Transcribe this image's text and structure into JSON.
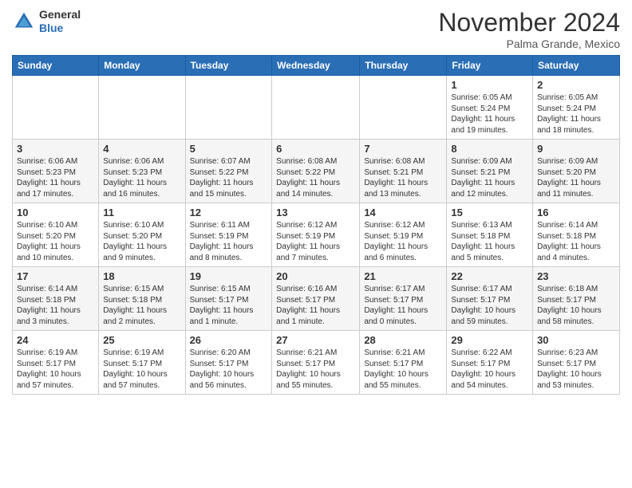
{
  "header": {
    "logo_line1": "General",
    "logo_line2": "Blue",
    "month": "November 2024",
    "location": "Palma Grande, Mexico"
  },
  "weekdays": [
    "Sunday",
    "Monday",
    "Tuesday",
    "Wednesday",
    "Thursday",
    "Friday",
    "Saturday"
  ],
  "weeks": [
    [
      {
        "day": "",
        "info": ""
      },
      {
        "day": "",
        "info": ""
      },
      {
        "day": "",
        "info": ""
      },
      {
        "day": "",
        "info": ""
      },
      {
        "day": "",
        "info": ""
      },
      {
        "day": "1",
        "info": "Sunrise: 6:05 AM\nSunset: 5:24 PM\nDaylight: 11 hours and 19 minutes."
      },
      {
        "day": "2",
        "info": "Sunrise: 6:05 AM\nSunset: 5:24 PM\nDaylight: 11 hours and 18 minutes."
      }
    ],
    [
      {
        "day": "3",
        "info": "Sunrise: 6:06 AM\nSunset: 5:23 PM\nDaylight: 11 hours and 17 minutes."
      },
      {
        "day": "4",
        "info": "Sunrise: 6:06 AM\nSunset: 5:23 PM\nDaylight: 11 hours and 16 minutes."
      },
      {
        "day": "5",
        "info": "Sunrise: 6:07 AM\nSunset: 5:22 PM\nDaylight: 11 hours and 15 minutes."
      },
      {
        "day": "6",
        "info": "Sunrise: 6:08 AM\nSunset: 5:22 PM\nDaylight: 11 hours and 14 minutes."
      },
      {
        "day": "7",
        "info": "Sunrise: 6:08 AM\nSunset: 5:21 PM\nDaylight: 11 hours and 13 minutes."
      },
      {
        "day": "8",
        "info": "Sunrise: 6:09 AM\nSunset: 5:21 PM\nDaylight: 11 hours and 12 minutes."
      },
      {
        "day": "9",
        "info": "Sunrise: 6:09 AM\nSunset: 5:20 PM\nDaylight: 11 hours and 11 minutes."
      }
    ],
    [
      {
        "day": "10",
        "info": "Sunrise: 6:10 AM\nSunset: 5:20 PM\nDaylight: 11 hours and 10 minutes."
      },
      {
        "day": "11",
        "info": "Sunrise: 6:10 AM\nSunset: 5:20 PM\nDaylight: 11 hours and 9 minutes."
      },
      {
        "day": "12",
        "info": "Sunrise: 6:11 AM\nSunset: 5:19 PM\nDaylight: 11 hours and 8 minutes."
      },
      {
        "day": "13",
        "info": "Sunrise: 6:12 AM\nSunset: 5:19 PM\nDaylight: 11 hours and 7 minutes."
      },
      {
        "day": "14",
        "info": "Sunrise: 6:12 AM\nSunset: 5:19 PM\nDaylight: 11 hours and 6 minutes."
      },
      {
        "day": "15",
        "info": "Sunrise: 6:13 AM\nSunset: 5:18 PM\nDaylight: 11 hours and 5 minutes."
      },
      {
        "day": "16",
        "info": "Sunrise: 6:14 AM\nSunset: 5:18 PM\nDaylight: 11 hours and 4 minutes."
      }
    ],
    [
      {
        "day": "17",
        "info": "Sunrise: 6:14 AM\nSunset: 5:18 PM\nDaylight: 11 hours and 3 minutes."
      },
      {
        "day": "18",
        "info": "Sunrise: 6:15 AM\nSunset: 5:18 PM\nDaylight: 11 hours and 2 minutes."
      },
      {
        "day": "19",
        "info": "Sunrise: 6:15 AM\nSunset: 5:17 PM\nDaylight: 11 hours and 1 minute."
      },
      {
        "day": "20",
        "info": "Sunrise: 6:16 AM\nSunset: 5:17 PM\nDaylight: 11 hours and 1 minute."
      },
      {
        "day": "21",
        "info": "Sunrise: 6:17 AM\nSunset: 5:17 PM\nDaylight: 11 hours and 0 minutes."
      },
      {
        "day": "22",
        "info": "Sunrise: 6:17 AM\nSunset: 5:17 PM\nDaylight: 10 hours and 59 minutes."
      },
      {
        "day": "23",
        "info": "Sunrise: 6:18 AM\nSunset: 5:17 PM\nDaylight: 10 hours and 58 minutes."
      }
    ],
    [
      {
        "day": "24",
        "info": "Sunrise: 6:19 AM\nSunset: 5:17 PM\nDaylight: 10 hours and 57 minutes."
      },
      {
        "day": "25",
        "info": "Sunrise: 6:19 AM\nSunset: 5:17 PM\nDaylight: 10 hours and 57 minutes."
      },
      {
        "day": "26",
        "info": "Sunrise: 6:20 AM\nSunset: 5:17 PM\nDaylight: 10 hours and 56 minutes."
      },
      {
        "day": "27",
        "info": "Sunrise: 6:21 AM\nSunset: 5:17 PM\nDaylight: 10 hours and 55 minutes."
      },
      {
        "day": "28",
        "info": "Sunrise: 6:21 AM\nSunset: 5:17 PM\nDaylight: 10 hours and 55 minutes."
      },
      {
        "day": "29",
        "info": "Sunrise: 6:22 AM\nSunset: 5:17 PM\nDaylight: 10 hours and 54 minutes."
      },
      {
        "day": "30",
        "info": "Sunrise: 6:23 AM\nSunset: 5:17 PM\nDaylight: 10 hours and 53 minutes."
      }
    ]
  ]
}
